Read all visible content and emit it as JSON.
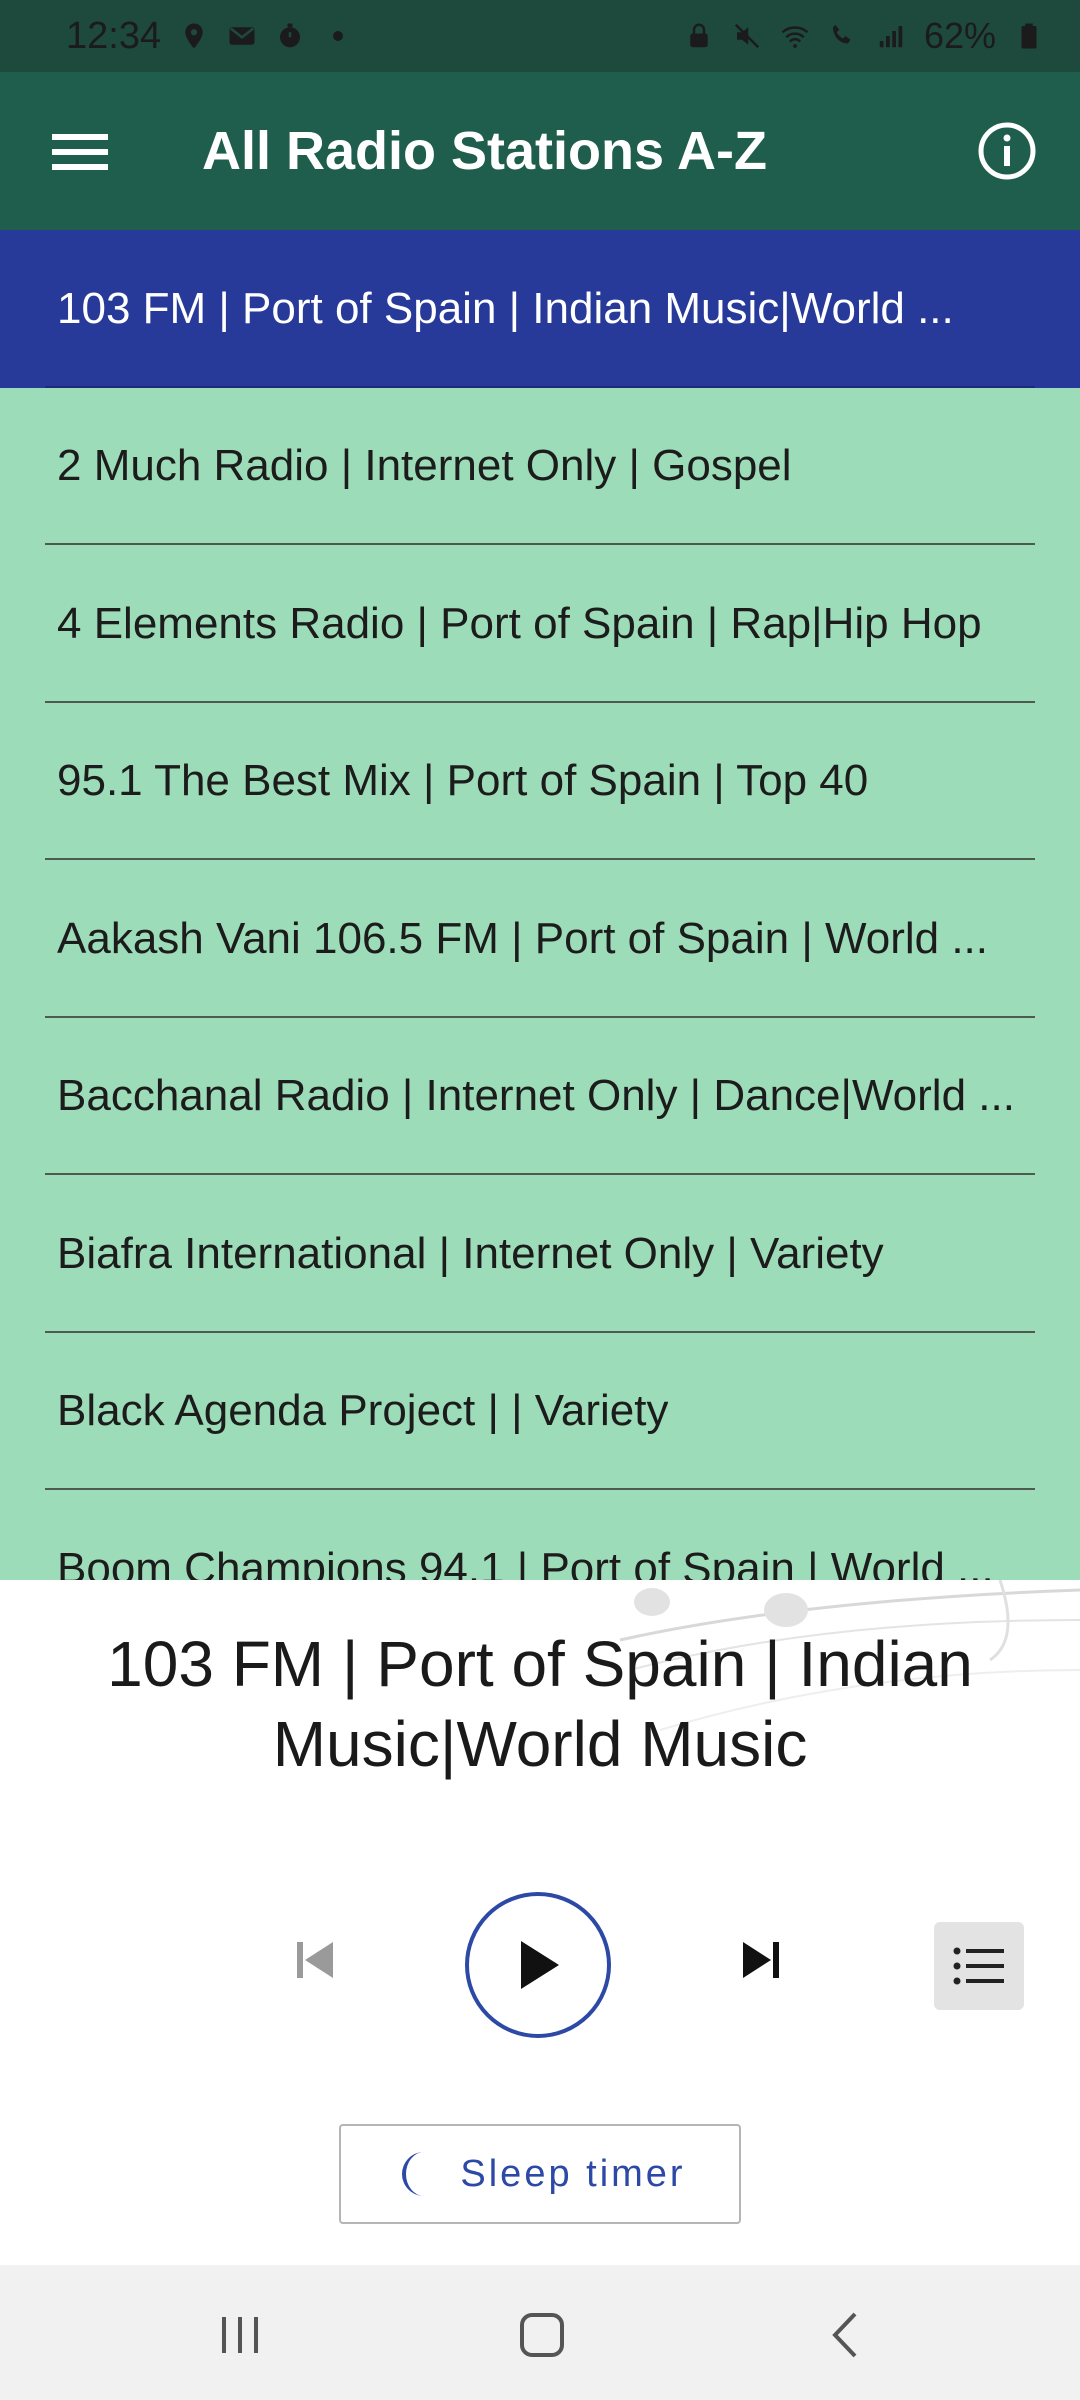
{
  "status_bar": {
    "time": "12:34",
    "battery": "62%",
    "icons": [
      "location-icon",
      "mail-icon",
      "timer-icon",
      "dot-icon",
      "lock-icon",
      "mute-icon",
      "wifi-icon",
      "wifi-call-icon",
      "signal-icon",
      "battery-icon"
    ]
  },
  "app_bar": {
    "title": "All Radio Stations A-Z",
    "menu_icon": "hamburger-menu-icon",
    "info_icon": "info-icon"
  },
  "stations": [
    {
      "label": "103 FM | Port of Spain | Indian Music|World ...",
      "selected": true
    },
    {
      "label": "2 Much Radio | Internet Only | Gospel",
      "selected": false
    },
    {
      "label": "4 Elements Radio | Port of Spain | Rap|Hip Hop",
      "selected": false
    },
    {
      "label": "95.1 The Best Mix | Port of Spain | Top 40",
      "selected": false
    },
    {
      "label": "Aakash Vani 106.5 FM | Port of Spain | World ...",
      "selected": false
    },
    {
      "label": "Bacchanal Radio | Internet Only | Dance|World ...",
      "selected": false
    },
    {
      "label": "Biafra International | Internet Only | Variety",
      "selected": false
    },
    {
      "label": "Black Agenda Project | | Variety",
      "selected": false
    },
    {
      "label": "Boom Champions 94.1 | Port of Spain | World ...",
      "selected": false
    }
  ],
  "player": {
    "now_playing": "103 FM | Port of Spain | Indian Music|World Music",
    "controls": [
      "previous-icon",
      "play-icon",
      "next-icon",
      "playlist-icon"
    ],
    "sleep_timer_label": "Sleep timer",
    "sleep_icon": "moon-icon"
  },
  "colors": {
    "status_bar": "#1e4a3e",
    "app_bar": "#1f5e4c",
    "list_background": "#9ddcb8",
    "selected_item": "#273a99",
    "accent": "#2d49a6"
  },
  "nav_bar": {
    "icons": [
      "recent-apps-icon",
      "home-icon",
      "back-icon"
    ]
  }
}
